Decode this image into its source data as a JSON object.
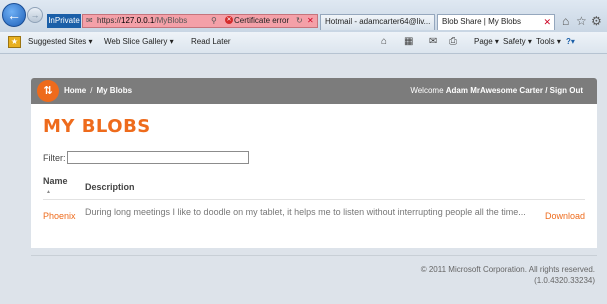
{
  "browser": {
    "inprivate_label": "InPrivate",
    "address": {
      "protocol": "https://",
      "host": "127.0.0.1",
      "path": "/MyBlobs"
    },
    "certificate_error": "Certificate error",
    "tabs": [
      {
        "label": "Hotmail - adamcarter64@liv...",
        "active": false
      },
      {
        "label": "Blob Share | My Blobs",
        "active": true
      }
    ],
    "favorites": {
      "suggested_sites": "Suggested Sites ▾",
      "web_slice_gallery": "Web Slice Gallery ▾",
      "read_later": "Read Later"
    },
    "commands": {
      "page": "Page ▾",
      "safety": "Safety ▾",
      "tools": "Tools ▾",
      "help": "?▾"
    }
  },
  "site": {
    "logo_glyph": "⇅",
    "breadcrumb": {
      "home": "Home",
      "separator": "/",
      "current": "My Blobs"
    },
    "welcome_prefix": "Welcome",
    "user_name": "Adam MrAwesome Carter",
    "sign_out": "/ Sign Out",
    "brand_color": "#ee6b1c"
  },
  "main": {
    "title": "MY BLOBS",
    "filter_label": "Filter:",
    "filter_value": "",
    "columns": {
      "name": "Name",
      "sort_indicator": "▲",
      "description": "Description"
    },
    "rows": [
      {
        "name": "Phoenix",
        "description": "During long meetings I like to doodle on my tablet, it helps me to listen without interrupting people all the time...",
        "action": "Download"
      }
    ]
  },
  "footer": {
    "copyright": "© 2011 Microsoft Corporation. All rights reserved.",
    "version": "(1.0.4320.33234)"
  }
}
